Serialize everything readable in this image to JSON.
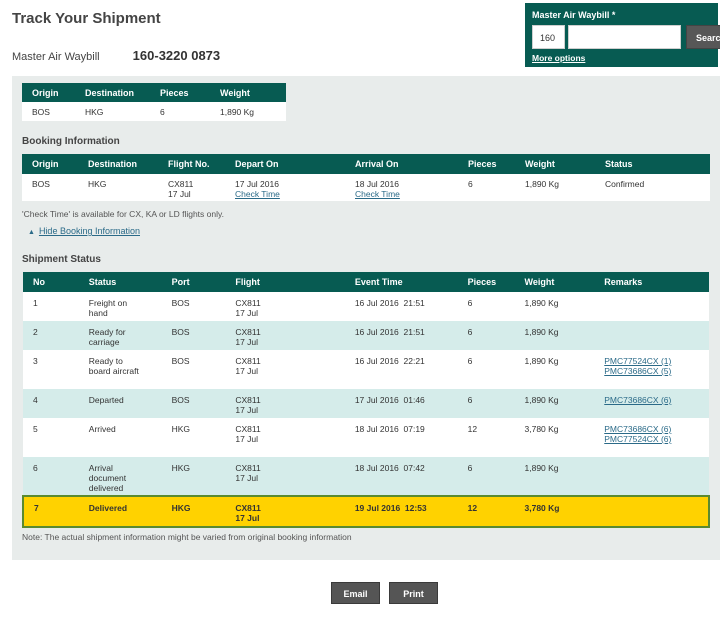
{
  "page": {
    "title": "Track Your Shipment",
    "awb_label": "Master Air Waybill",
    "awb_number": "160-3220 0873"
  },
  "search": {
    "label": "Master Air Waybill *",
    "prefix_value": "160",
    "number_value": "",
    "button_label": "Search",
    "more_options": "More options"
  },
  "summary": {
    "headers": [
      "Origin",
      "Destination",
      "Pieces",
      "Weight"
    ],
    "row": [
      "BOS",
      "HKG",
      "6",
      "1,890 Kg"
    ]
  },
  "booking": {
    "title": "Booking Information",
    "headers": [
      "Origin",
      "Destination",
      "Flight No.",
      "Depart On",
      "Arrival On",
      "Pieces",
      "Weight",
      "Status"
    ],
    "row": {
      "origin": "BOS",
      "destination": "HKG",
      "flight_no": "CX811",
      "flight_date": "17 Jul",
      "depart_date": "17 Jul 2016",
      "depart_link": "Check Time",
      "arrival_date": "18 Jul 2016",
      "arrival_link": "Check Time",
      "pieces": "6",
      "weight": "1,890 Kg",
      "status": "Confirmed"
    },
    "note": "'Check Time' is available for CX, KA or LD flights only.",
    "hide_link": "Hide Booking Information"
  },
  "shipment": {
    "title": "Shipment Status",
    "headers": [
      "No",
      "Status",
      "Port",
      "Flight",
      "Event Time",
      "Pieces",
      "Weight",
      "Remarks"
    ],
    "rows": [
      {
        "no": "1",
        "status": [
          "Freight on",
          "hand"
        ],
        "port": "BOS",
        "flight": "CX811",
        "flight_date": "17 Jul",
        "event_time": "16 Jul 2016  21:51",
        "pieces": "6",
        "weight": "1,890 Kg",
        "remarks": [],
        "style": "white",
        "height": 29
      },
      {
        "no": "2",
        "status": [
          "Ready for",
          "carriage"
        ],
        "port": "BOS",
        "flight": "CX811",
        "flight_date": "17 Jul",
        "event_time": "16 Jul 2016  21:51",
        "pieces": "6",
        "weight": "1,890 Kg",
        "remarks": [],
        "style": "teal",
        "height": 29
      },
      {
        "no": "3",
        "status": [
          "Ready to",
          "board aircraft"
        ],
        "port": "BOS",
        "flight": "CX811",
        "flight_date": "17 Jul",
        "event_time": "16 Jul 2016  22:21",
        "pieces": "6",
        "weight": "1,890 Kg",
        "remarks": [
          "PMC77524CX (1)",
          "PMC73686CX (5)"
        ],
        "style": "white",
        "height": 39
      },
      {
        "no": "4",
        "status": [
          "Departed"
        ],
        "port": "BOS",
        "flight": "CX811",
        "flight_date": "17 Jul",
        "event_time": "17 Jul 2016  01:46",
        "pieces": "6",
        "weight": "1,890 Kg",
        "remarks": [
          "PMC73686CX (6)"
        ],
        "style": "teal",
        "height": 29
      },
      {
        "no": "5",
        "status": [
          "Arrived"
        ],
        "port": "HKG",
        "flight": "CX811",
        "flight_date": "17 Jul",
        "event_time": "18 Jul 2016  07:19",
        "pieces": "12",
        "weight": "3,780 Kg",
        "remarks": [
          "PMC73686CX (6)",
          "PMC77524CX (6)"
        ],
        "style": "white",
        "height": 39
      },
      {
        "no": "6",
        "status": [
          "Arrival",
          "document",
          "delivered"
        ],
        "port": "HKG",
        "flight": "CX811",
        "flight_date": "17 Jul",
        "event_time": "18 Jul 2016  07:42",
        "pieces": "6",
        "weight": "1,890 Kg",
        "remarks": [],
        "style": "teal",
        "height": 39
      },
      {
        "no": "7",
        "status": [
          "Delivered"
        ],
        "port": "HKG",
        "flight": "CX811",
        "flight_date": "17 Jul",
        "event_time": "19 Jul 2016  12:53",
        "pieces": "12",
        "weight": "3,780 Kg",
        "remarks": [],
        "style": "yellow",
        "height": 31
      }
    ],
    "note": "Note: The actual shipment information might be varied from original booking information"
  },
  "actions": {
    "email_label": "Email",
    "print_label": "Print"
  },
  "colors": {
    "header_teal": "#075b52",
    "row_teal": "#d5ecea",
    "highlight_yellow": "#ffd200",
    "panel_gray": "#e8eceb"
  }
}
